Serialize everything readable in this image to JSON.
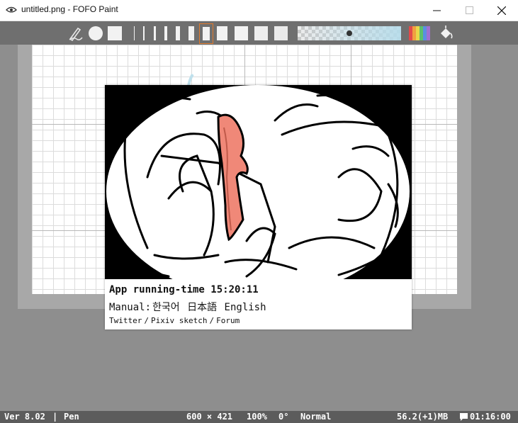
{
  "window": {
    "title": "untitled.png - FOFO Paint"
  },
  "toolbar": {
    "tools": [
      "pen-icon",
      "brush-size-dot-icon",
      "square-brush-icon"
    ],
    "brush_widths": 8,
    "selected_width_index": 5,
    "gray_swatches": 4,
    "accent_color": "#e07a2e"
  },
  "dialog": {
    "runtime": "App running-time 15:20:11",
    "manual_label": "Manual:",
    "manual_links": [
      "한국어",
      "日本語",
      "English"
    ],
    "links": [
      "Twitter",
      "Pixiv sketch",
      "Forum"
    ],
    "separator": "/",
    "art_accent": "#f08878"
  },
  "status": {
    "version": "Ver 8.02",
    "divider": "|",
    "tool": "Pen",
    "canvas_size": "600 × 421",
    "zoom": "100%",
    "rotation": "0°",
    "blend": "Normal",
    "memory": "56.2(+1)MB",
    "time": "01:16:00"
  }
}
